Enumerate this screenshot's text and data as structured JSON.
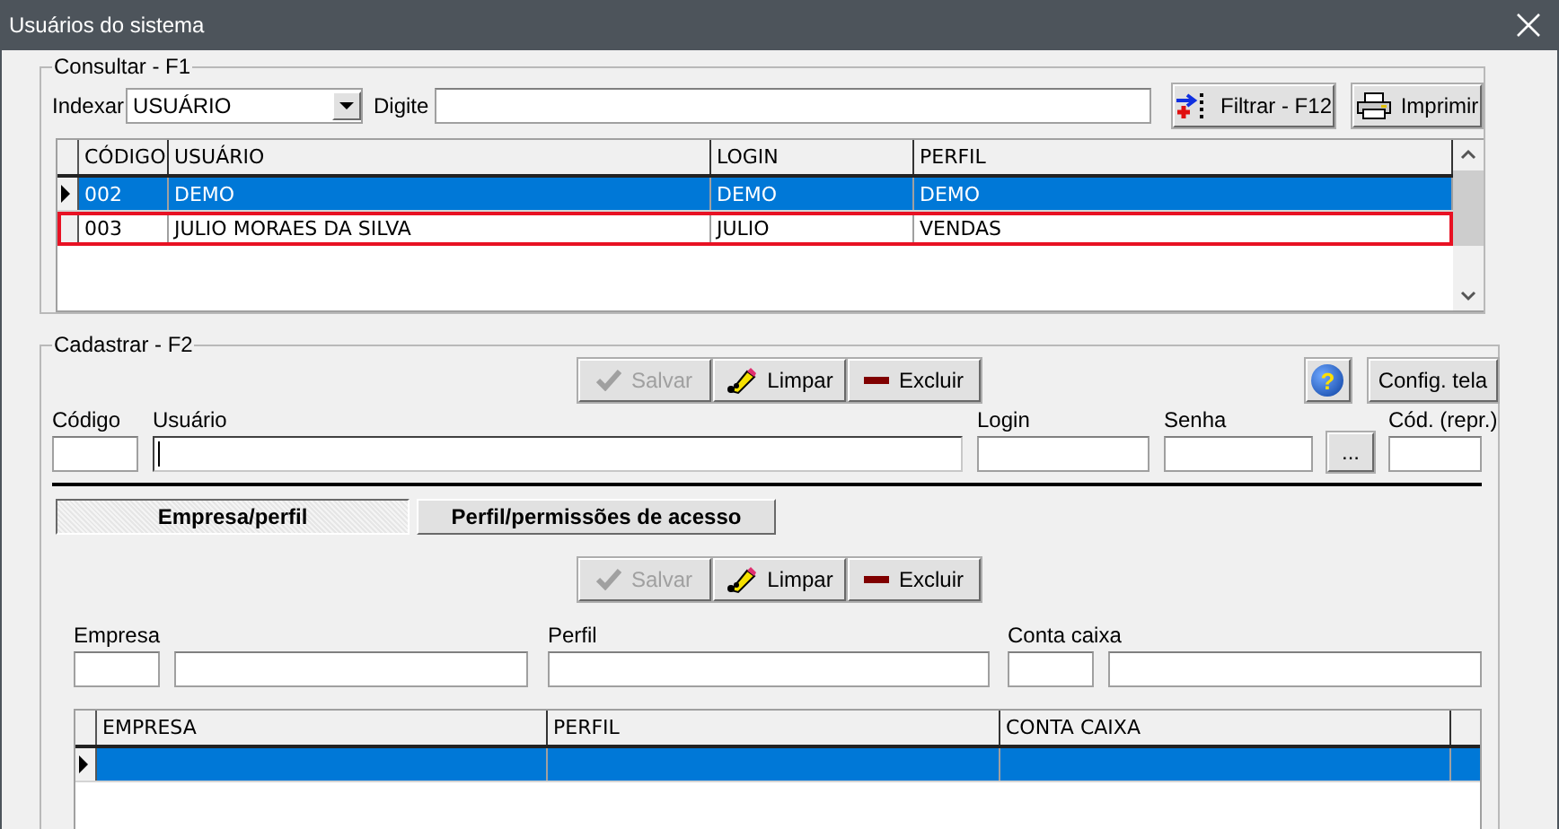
{
  "window": {
    "title": "Usuários do sistema"
  },
  "consultar": {
    "legend": "Consultar - F1",
    "index_label": "Indexar",
    "index_value": "USUÁRIO",
    "search_label": "Digite",
    "buttons": [
      {
        "label": "Filtrar - F12",
        "kind": "filter"
      },
      {
        "label": "Imprimir",
        "kind": "print"
      }
    ],
    "table": {
      "columns": [
        "CÓDIGO",
        "USUÁRIO",
        "LOGIN",
        "PERFIL"
      ],
      "rows": [
        {
          "cells": [
            "002",
            "DEMO",
            "DEMO",
            "DEMO"
          ],
          "selected": true,
          "outlined": false
        },
        {
          "cells": [
            "003",
            "JULIO MORAES DA SILVA",
            "JULIO",
            "VENDAS"
          ],
          "selected": false,
          "outlined": true
        }
      ]
    }
  },
  "cadastrar": {
    "legend": "Cadastrar - F2",
    "buttons": [
      {
        "label": "Salvar",
        "kind": "save",
        "disabled": true
      },
      {
        "label": "Limpar",
        "kind": "clear",
        "disabled": false
      },
      {
        "label": "Excluir",
        "kind": "delete",
        "disabled": false
      }
    ],
    "help_button": {
      "label": "?"
    },
    "config_button": {
      "label": "Config. tela"
    },
    "fields": [
      {
        "kind": "field",
        "label": "Código",
        "focused": false
      },
      {
        "kind": "field",
        "label": "Usuário",
        "focused": true
      },
      {
        "kind": "field",
        "label": "Login",
        "focused": false
      },
      {
        "kind": "field",
        "label": "Senha",
        "focused": false
      },
      {
        "kind": "button",
        "label": "..."
      },
      {
        "kind": "field",
        "label": "Cód. (repr.)",
        "focused": false
      }
    ],
    "tabs": [
      {
        "label": "Empresa/perfil",
        "selected": true
      },
      {
        "label": "Perfil/permissões de acesso",
        "selected": false
      }
    ],
    "tab_buttons": [
      {
        "label": "Salvar",
        "kind": "save",
        "disabled": true
      },
      {
        "label": "Limpar",
        "kind": "clear",
        "disabled": false
      },
      {
        "label": "Excluir",
        "kind": "delete",
        "disabled": false
      }
    ],
    "tab_fields": [
      {
        "label": "Empresa",
        "kind": "code_name"
      },
      {
        "label": "Perfil",
        "kind": "single"
      },
      {
        "label": "Conta caixa",
        "kind": "code_name"
      }
    ],
    "tab_table": {
      "columns": [
        "EMPRESA",
        "PERFIL",
        "CONTA CAIXA"
      ],
      "rows": [
        {
          "selected": true
        }
      ]
    }
  }
}
